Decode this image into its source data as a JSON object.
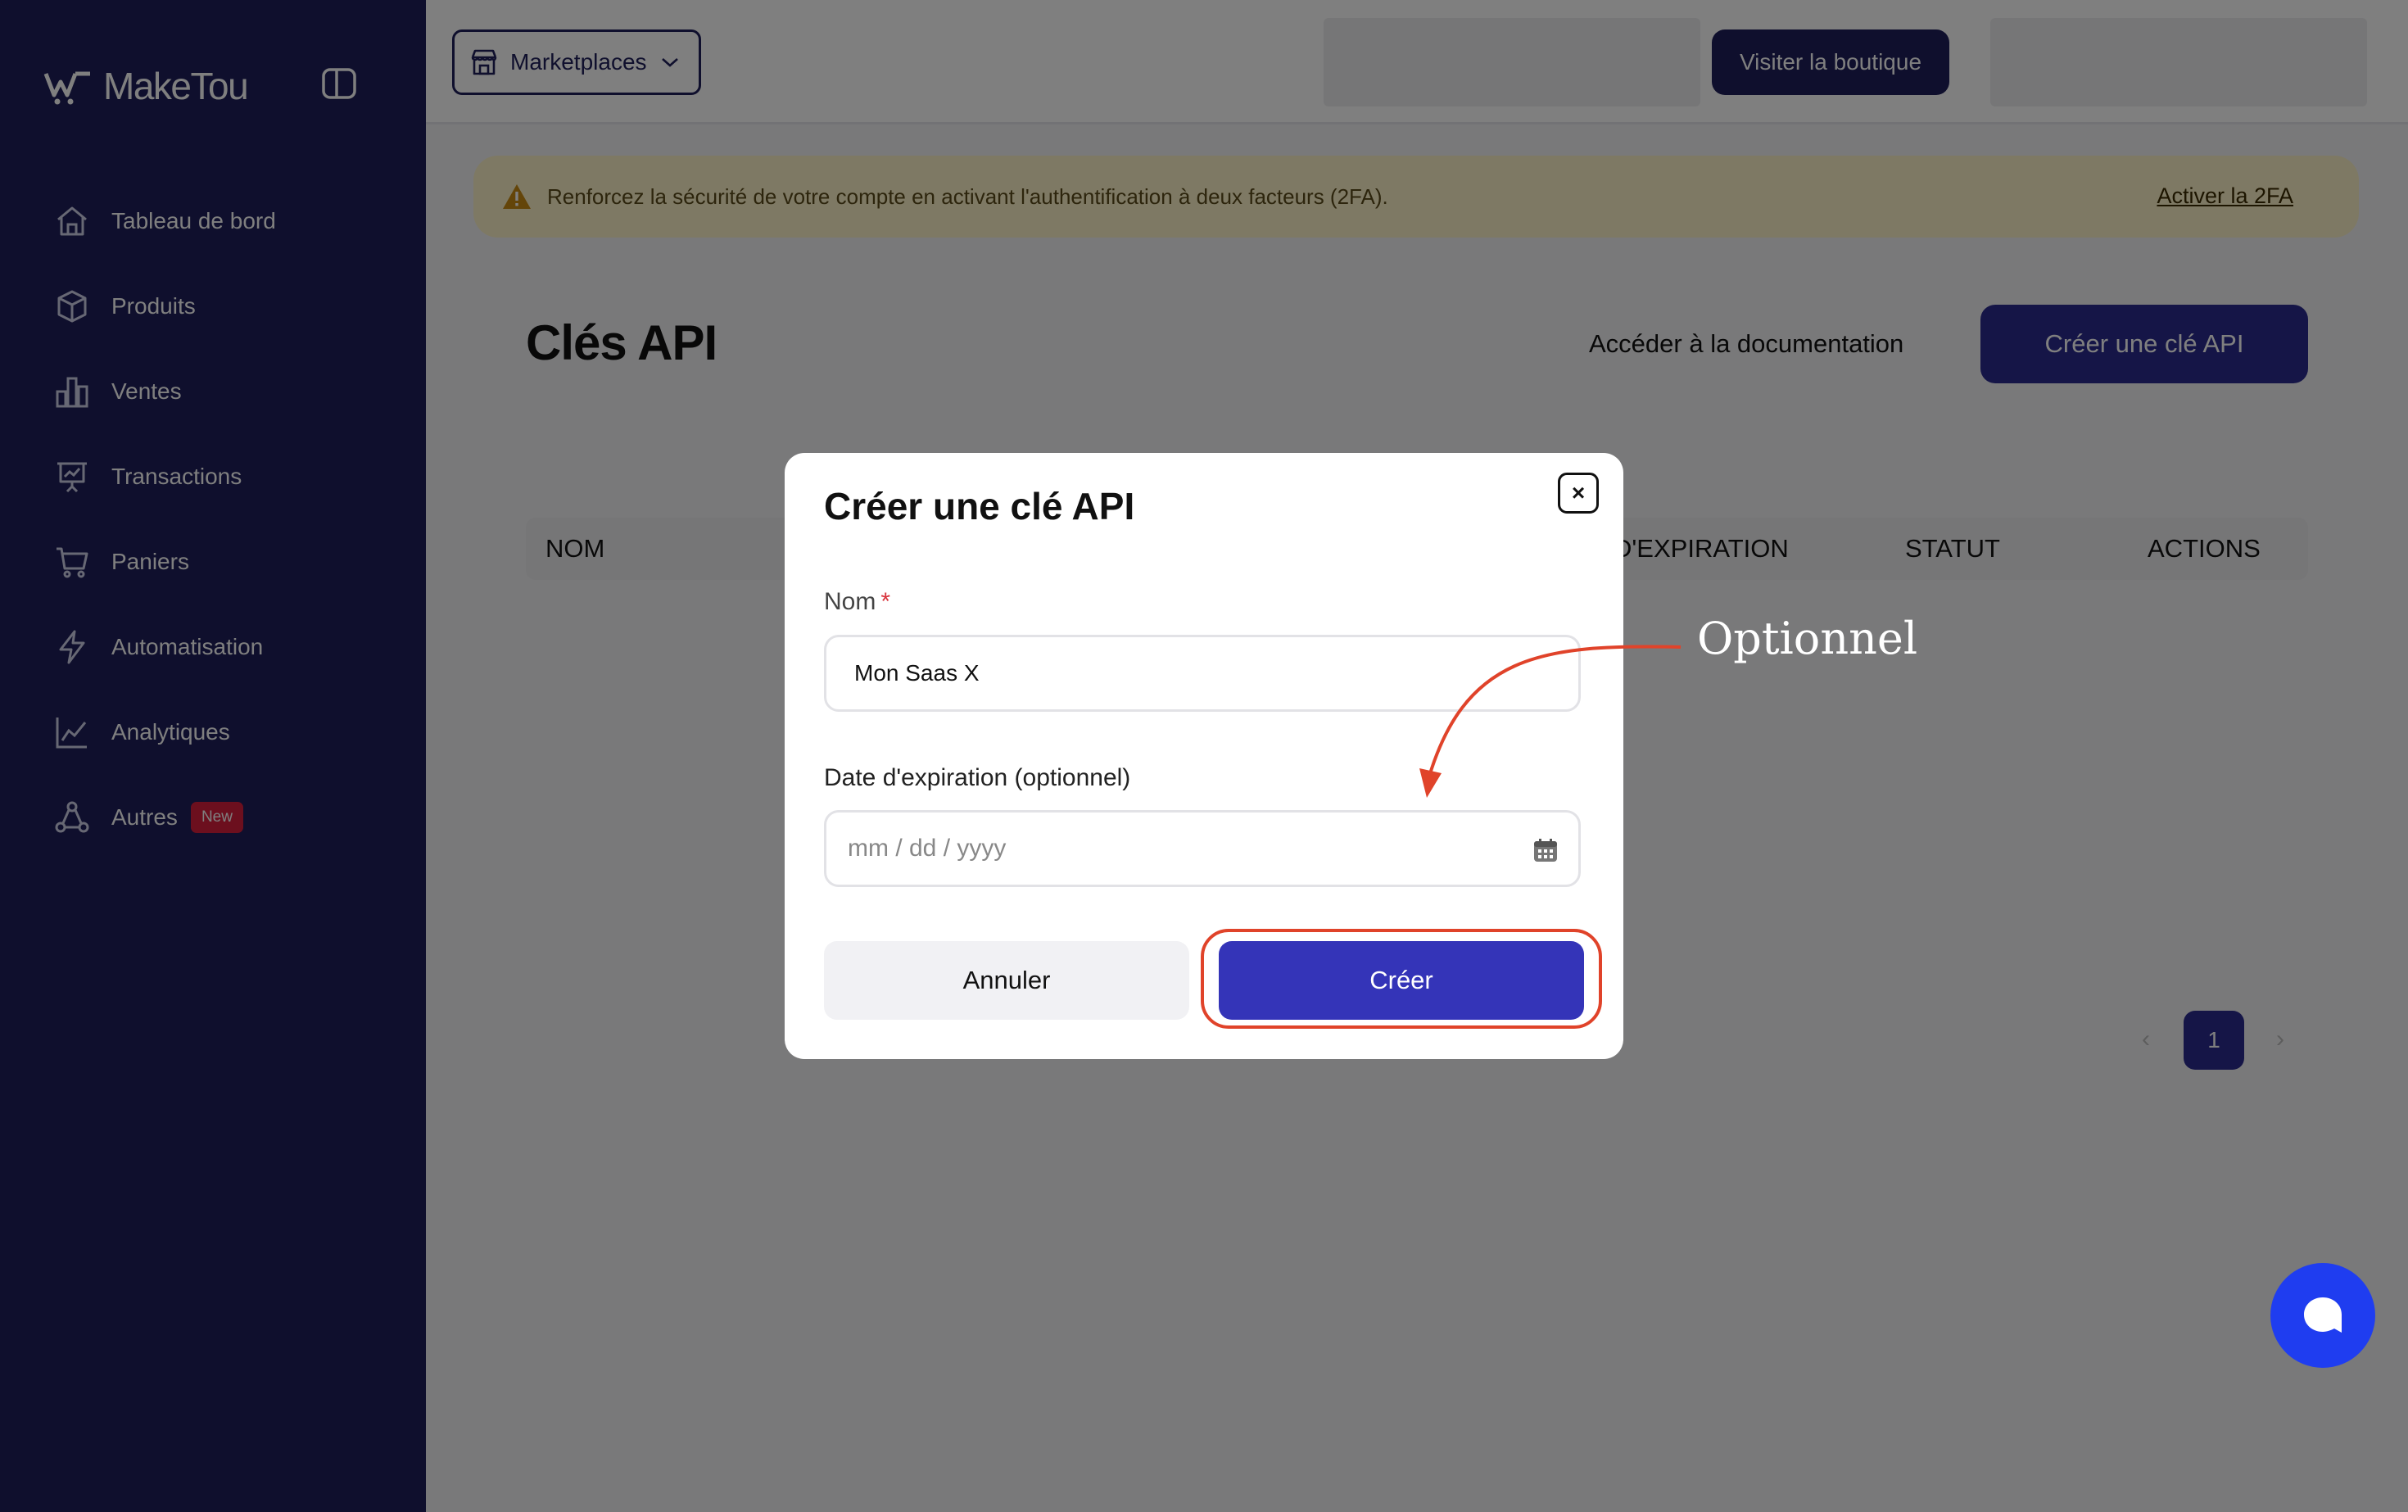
{
  "sidebar": {
    "logo_text": "MakeTou",
    "items": [
      {
        "label": "Tableau de bord",
        "icon": "home-icon"
      },
      {
        "label": "Produits",
        "icon": "box-icon"
      },
      {
        "label": "Ventes",
        "icon": "bar-chart-icon"
      },
      {
        "label": "Transactions",
        "icon": "presentation-icon"
      },
      {
        "label": "Paniers",
        "icon": "cart-icon"
      },
      {
        "label": "Automatisation",
        "icon": "lightning-icon"
      },
      {
        "label": "Analytiques",
        "icon": "line-chart-icon"
      },
      {
        "label": "Autres",
        "icon": "network-icon",
        "badge": "New"
      }
    ]
  },
  "header": {
    "marketplace_label": "Marketplaces",
    "visit_label": "Visiter la boutique"
  },
  "banner": {
    "text": "Renforcez la sécurité de votre compte en activant l'authentification à deux facteurs (2FA).",
    "link": "Activer la 2FA"
  },
  "page": {
    "title": "Clés API",
    "doc_link": "Accéder à la documentation",
    "create_button": "Créer une clé API"
  },
  "table": {
    "headers": [
      "NOM",
      "D'EXPIRATION",
      "STATUT",
      "ACTIONS"
    ]
  },
  "pagination": {
    "prev": "‹",
    "current": "1",
    "next": "›"
  },
  "modal": {
    "title": "Créer une clé API",
    "close": "×",
    "name_label": "Nom",
    "required_mark": "*",
    "name_value": "Mon Saas X",
    "date_label": "Date d'expiration (optionnel)",
    "date_placeholder": "mm / dd / yyyy",
    "cancel": "Annuler",
    "create": "Créer"
  },
  "annotation": {
    "text": "Optionnel"
  },
  "colors": {
    "sidebar_bg": "#1e1e5a",
    "primary": "#2a2a8f",
    "create_button": "#3434b8",
    "annotation_red": "#e0432a",
    "chat_blue": "#1f3df0",
    "banner_bg": "#fdf3c8",
    "badge_red": "#d81f3c"
  }
}
